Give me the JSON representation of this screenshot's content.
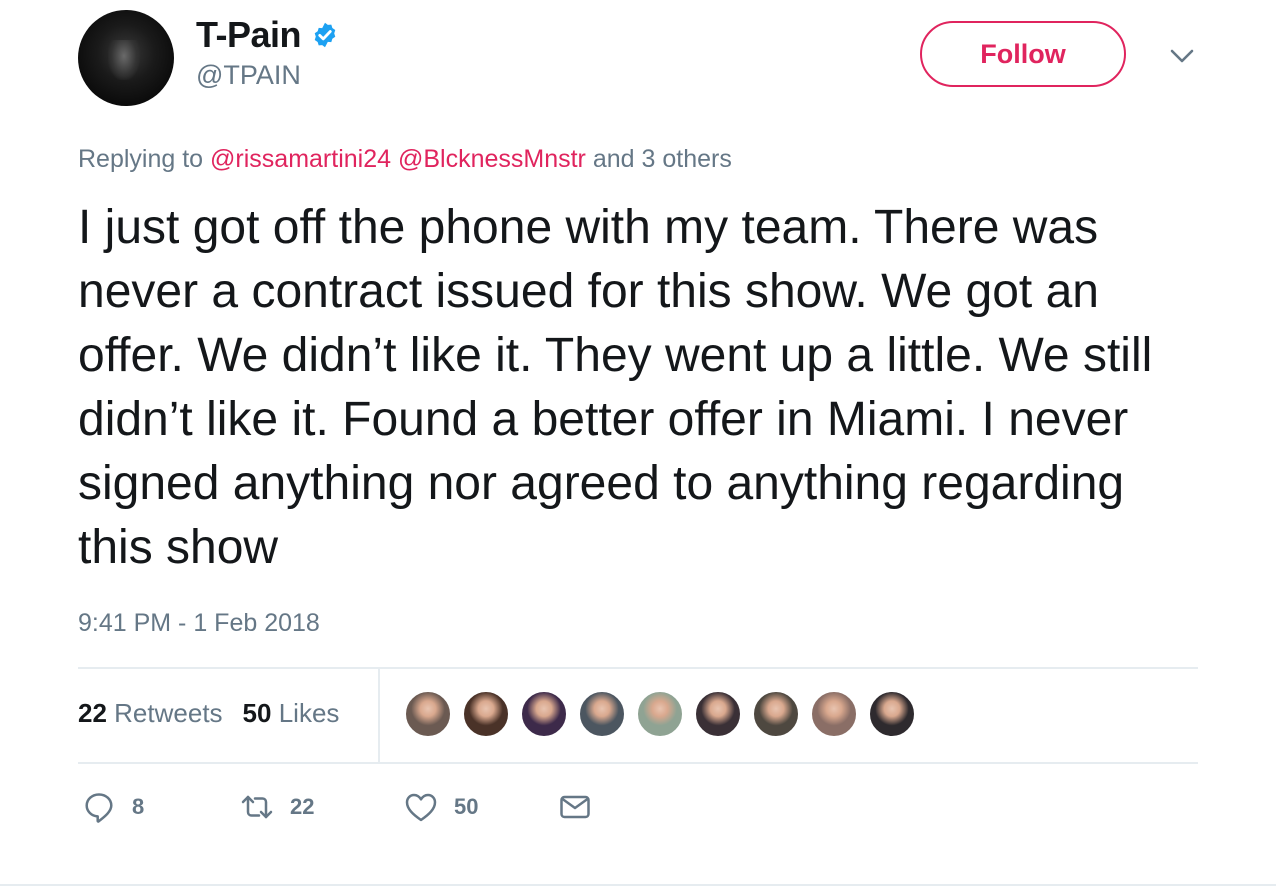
{
  "user": {
    "display_name": "T-Pain",
    "handle": "@TPAIN",
    "verified": true
  },
  "follow_label": "Follow",
  "reply_context": {
    "prefix": "Replying to",
    "mention1": "@rissamartini24",
    "mention2": "@BlcknessMnstr",
    "suffix": "and 3 others"
  },
  "tweet": {
    "text": "I just got off the phone with my team. There was never a contract issued for this show. We got an offer. We didn’t like it. They went up a little. We still didn’t like it. Found a better offer in Miami. I never signed anything nor agreed to anything regarding this show",
    "timestamp": "9:41 PM - 1 Feb 2018"
  },
  "stats": {
    "retweets_count": "22",
    "retweets_label": "Retweets",
    "likes_count": "50",
    "likes_label": "Likes"
  },
  "liker_avatars": [
    "#6b5a52",
    "#4a3228",
    "#3d2a4a",
    "#4c5660",
    "#8fa393",
    "#3a3036",
    "#4e4840",
    "#8a6e66",
    "#2e2a2e"
  ],
  "actions": {
    "reply_count": "8",
    "retweet_count": "22",
    "like_count": "50"
  },
  "colors": {
    "accent": "#e0245e",
    "verified": "#1da1f2",
    "muted": "#657786"
  },
  "icons": [
    "verified-badge-icon",
    "chevron-down-icon",
    "reply-icon",
    "retweet-icon",
    "heart-icon",
    "mail-icon"
  ]
}
